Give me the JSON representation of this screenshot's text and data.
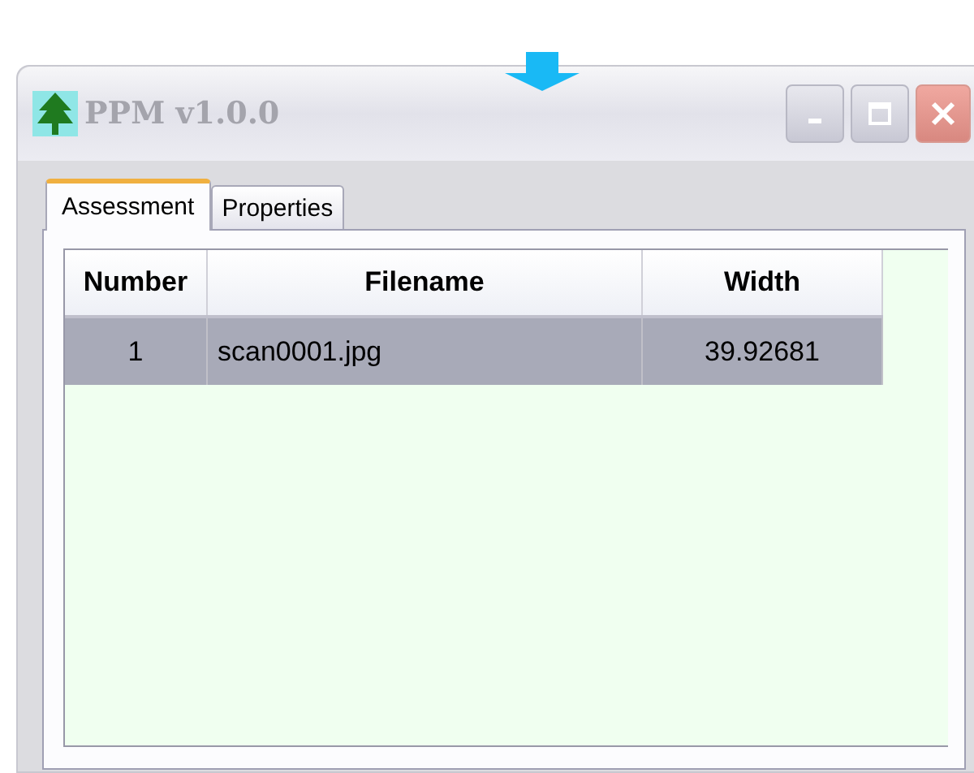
{
  "window": {
    "title": "PPM v1.0.0"
  },
  "tabs": [
    {
      "label": "Assessment",
      "selected": true
    },
    {
      "label": "Properties",
      "selected": false
    }
  ],
  "table": {
    "columns": [
      "Number",
      "Filename",
      "Width"
    ],
    "rows": [
      {
        "cells": [
          "1",
          "scan0001.jpg",
          "39.92681"
        ],
        "selected": true
      }
    ]
  }
}
